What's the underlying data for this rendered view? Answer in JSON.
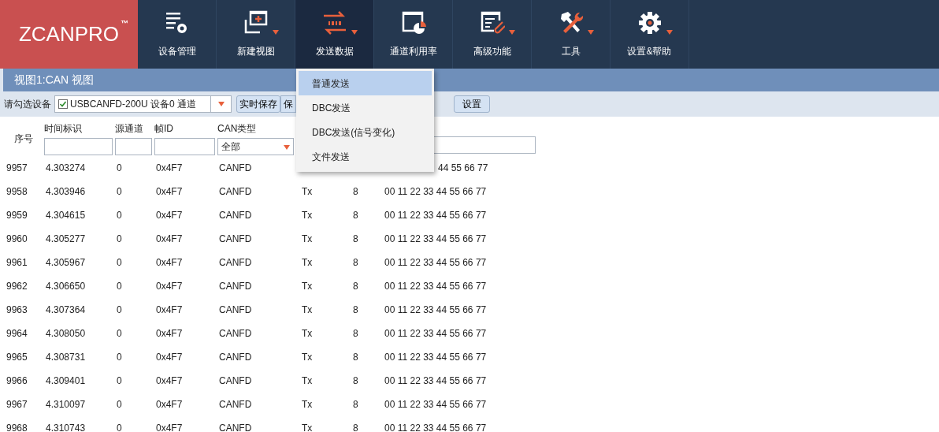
{
  "logo": {
    "text": "ZCANPRO",
    "mark": "™"
  },
  "nav": [
    {
      "label": "设备管理",
      "dropdown": false,
      "selected": false
    },
    {
      "label": "新建视图",
      "dropdown": true,
      "selected": false
    },
    {
      "label": "发送数据",
      "dropdown": true,
      "selected": true
    },
    {
      "label": "通道利用率",
      "dropdown": false,
      "selected": false
    },
    {
      "label": "高级功能",
      "dropdown": true,
      "selected": false
    },
    {
      "label": "工具",
      "dropdown": true,
      "selected": false
    },
    {
      "label": "设置&帮助",
      "dropdown": true,
      "selected": false
    }
  ],
  "menu": [
    {
      "label": "普通发送",
      "selected": true
    },
    {
      "label": "DBC发送",
      "selected": false
    },
    {
      "label": "DBC发送(信号变化)",
      "selected": false
    },
    {
      "label": "文件发送",
      "selected": false
    }
  ],
  "view_title": "视图1:CAN 视图",
  "toolbar": {
    "device_label": "请勾选设备",
    "device": {
      "text": "USBCANFD-200U 设备0 通道",
      "checked": true
    },
    "buttons": [
      "实时保存",
      "保",
      "设置"
    ]
  },
  "table": {
    "columns": [
      "序号",
      "时间标识",
      "源通道",
      "帧ID",
      "CAN类型"
    ],
    "type_filter": "全部",
    "rows": [
      {
        "index": "9957",
        "time": "4.303274",
        "channel": "0",
        "id": "0x4F7",
        "type": "CANFD",
        "data": "44 55 66 77",
        "covered": true
      },
      {
        "index": "9958",
        "time": "4.303946",
        "channel": "0",
        "id": "0x4F7",
        "type": "CANFD",
        "dir": "Tx",
        "dlc": "8",
        "data": "00 11 22 33 44 55 66 77",
        "covered": false
      },
      {
        "index": "9959",
        "time": "4.304615",
        "channel": "0",
        "id": "0x4F7",
        "type": "CANFD",
        "dir": "Tx",
        "dlc": "8",
        "data": "00 11 22 33 44 55 66 77",
        "covered": false
      },
      {
        "index": "9960",
        "time": "4.305277",
        "channel": "0",
        "id": "0x4F7",
        "type": "CANFD",
        "dir": "Tx",
        "dlc": "8",
        "data": "00 11 22 33 44 55 66 77",
        "covered": false
      },
      {
        "index": "9961",
        "time": "4.305967",
        "channel": "0",
        "id": "0x4F7",
        "type": "CANFD",
        "dir": "Tx",
        "dlc": "8",
        "data": "00 11 22 33 44 55 66 77",
        "covered": false
      },
      {
        "index": "9962",
        "time": "4.306650",
        "channel": "0",
        "id": "0x4F7",
        "type": "CANFD",
        "dir": "Tx",
        "dlc": "8",
        "data": "00 11 22 33 44 55 66 77",
        "covered": false
      },
      {
        "index": "9963",
        "time": "4.307364",
        "channel": "0",
        "id": "0x4F7",
        "type": "CANFD",
        "dir": "Tx",
        "dlc": "8",
        "data": "00 11 22 33 44 55 66 77",
        "covered": false
      },
      {
        "index": "9964",
        "time": "4.308050",
        "channel": "0",
        "id": "0x4F7",
        "type": "CANFD",
        "dir": "Tx",
        "dlc": "8",
        "data": "00 11 22 33 44 55 66 77",
        "covered": false
      },
      {
        "index": "9965",
        "time": "4.308731",
        "channel": "0",
        "id": "0x4F7",
        "type": "CANFD",
        "dir": "Tx",
        "dlc": "8",
        "data": "00 11 22 33 44 55 66 77",
        "covered": false
      },
      {
        "index": "9966",
        "time": "4.309401",
        "channel": "0",
        "id": "0x4F7",
        "type": "CANFD",
        "dir": "Tx",
        "dlc": "8",
        "data": "00 11 22 33 44 55 66 77",
        "covered": false
      },
      {
        "index": "9967",
        "time": "4.310097",
        "channel": "0",
        "id": "0x4F7",
        "type": "CANFD",
        "dir": "Tx",
        "dlc": "8",
        "data": "00 11 22 33 44 55 66 77",
        "covered": false
      },
      {
        "index": "9968",
        "time": "4.310743",
        "channel": "0",
        "id": "0x4F7",
        "type": "CANFD",
        "dir": "Tx",
        "dlc": "8",
        "data": "00 11 22 33 44 55 66 77",
        "covered": false
      }
    ]
  }
}
